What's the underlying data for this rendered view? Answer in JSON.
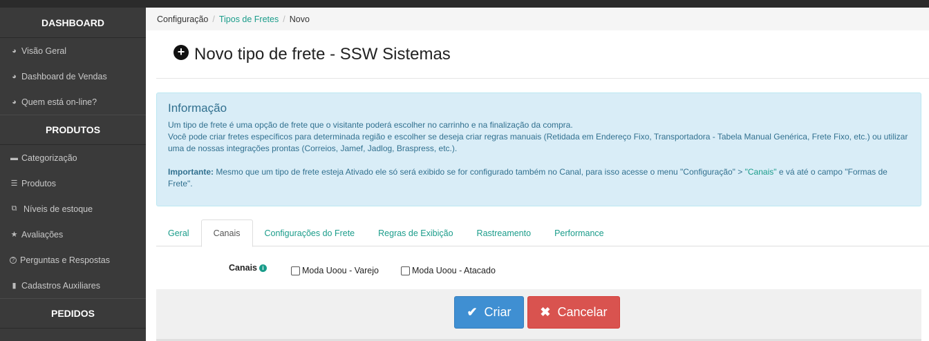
{
  "sidebar": {
    "sections": [
      {
        "title": "DASHBOARD",
        "items": [
          {
            "icon": "dashboard-icon",
            "glyph": "◕",
            "label": "Visão Geral"
          },
          {
            "icon": "dashboard-icon",
            "glyph": "◕",
            "label": "Dashboard de Vendas"
          },
          {
            "icon": "dashboard-icon",
            "glyph": "◕",
            "label": "Quem está on-line?"
          }
        ]
      },
      {
        "title": "PRODUTOS",
        "items": [
          {
            "icon": "folder-icon",
            "glyph": "▬",
            "label": "Categorização"
          },
          {
            "icon": "list-icon",
            "glyph": "☰",
            "label": "Produtos"
          },
          {
            "icon": "cubes-icon",
            "glyph": "⧉",
            "label": "Níveis de estoque"
          },
          {
            "icon": "star-icon",
            "glyph": "★",
            "label": "Avaliações"
          },
          {
            "icon": "question-circle-icon",
            "glyph": "?",
            "label": "Perguntas e Respostas"
          },
          {
            "icon": "file-icon",
            "glyph": "▮",
            "label": "Cadastros Auxiliares"
          }
        ]
      },
      {
        "title": "PEDIDOS",
        "items": []
      }
    ]
  },
  "breadcrumb": {
    "items": [
      "Configuração",
      "Tipos de Fretes",
      "Novo"
    ]
  },
  "page": {
    "title": "Novo tipo de frete - SSW Sistemas"
  },
  "info": {
    "heading": "Informação",
    "line1": "Um tipo de frete é uma opção de frete que o visitante poderá escolher no carrinho e na finalização da compra.",
    "line2": "Você pode criar fretes específicos para determinada região e escolher se deseja criar regras manuais (Retidada em Endereço Fixo, Transportadora - Tabela Manual Genérica, Frete Fixo, etc.) ou utilizar uma de nossas integrações prontas (Correios, Jamef, Jadlog, Braspress, etc.).",
    "important_label": "Importante:",
    "important_text_a": " Mesmo que um tipo de frete esteja Ativado ele só será exibido se for configurado também no Canal, para isso acesse o menu \"Configuração\" > ",
    "important_link": "\"Canais\"",
    "important_text_b": " e vá até o campo \"Formas de Frete\"."
  },
  "tabs": [
    "Geral",
    "Canais",
    "Configurações do Frete",
    "Regras de Exibição",
    "Rastreamento",
    "Performance"
  ],
  "active_tab": "Canais",
  "form": {
    "label": "Canais",
    "options": [
      "Moda Uoou - Varejo",
      "Moda Uoou - Atacado"
    ]
  },
  "buttons": {
    "create": "Criar",
    "cancel": "Cancelar"
  },
  "colors": {
    "accent": "#1a9c8a",
    "primary": "#3f8fd2",
    "danger": "#d9534f",
    "sidebar": "#3a3a3a",
    "info_bg": "#d9edf7"
  }
}
